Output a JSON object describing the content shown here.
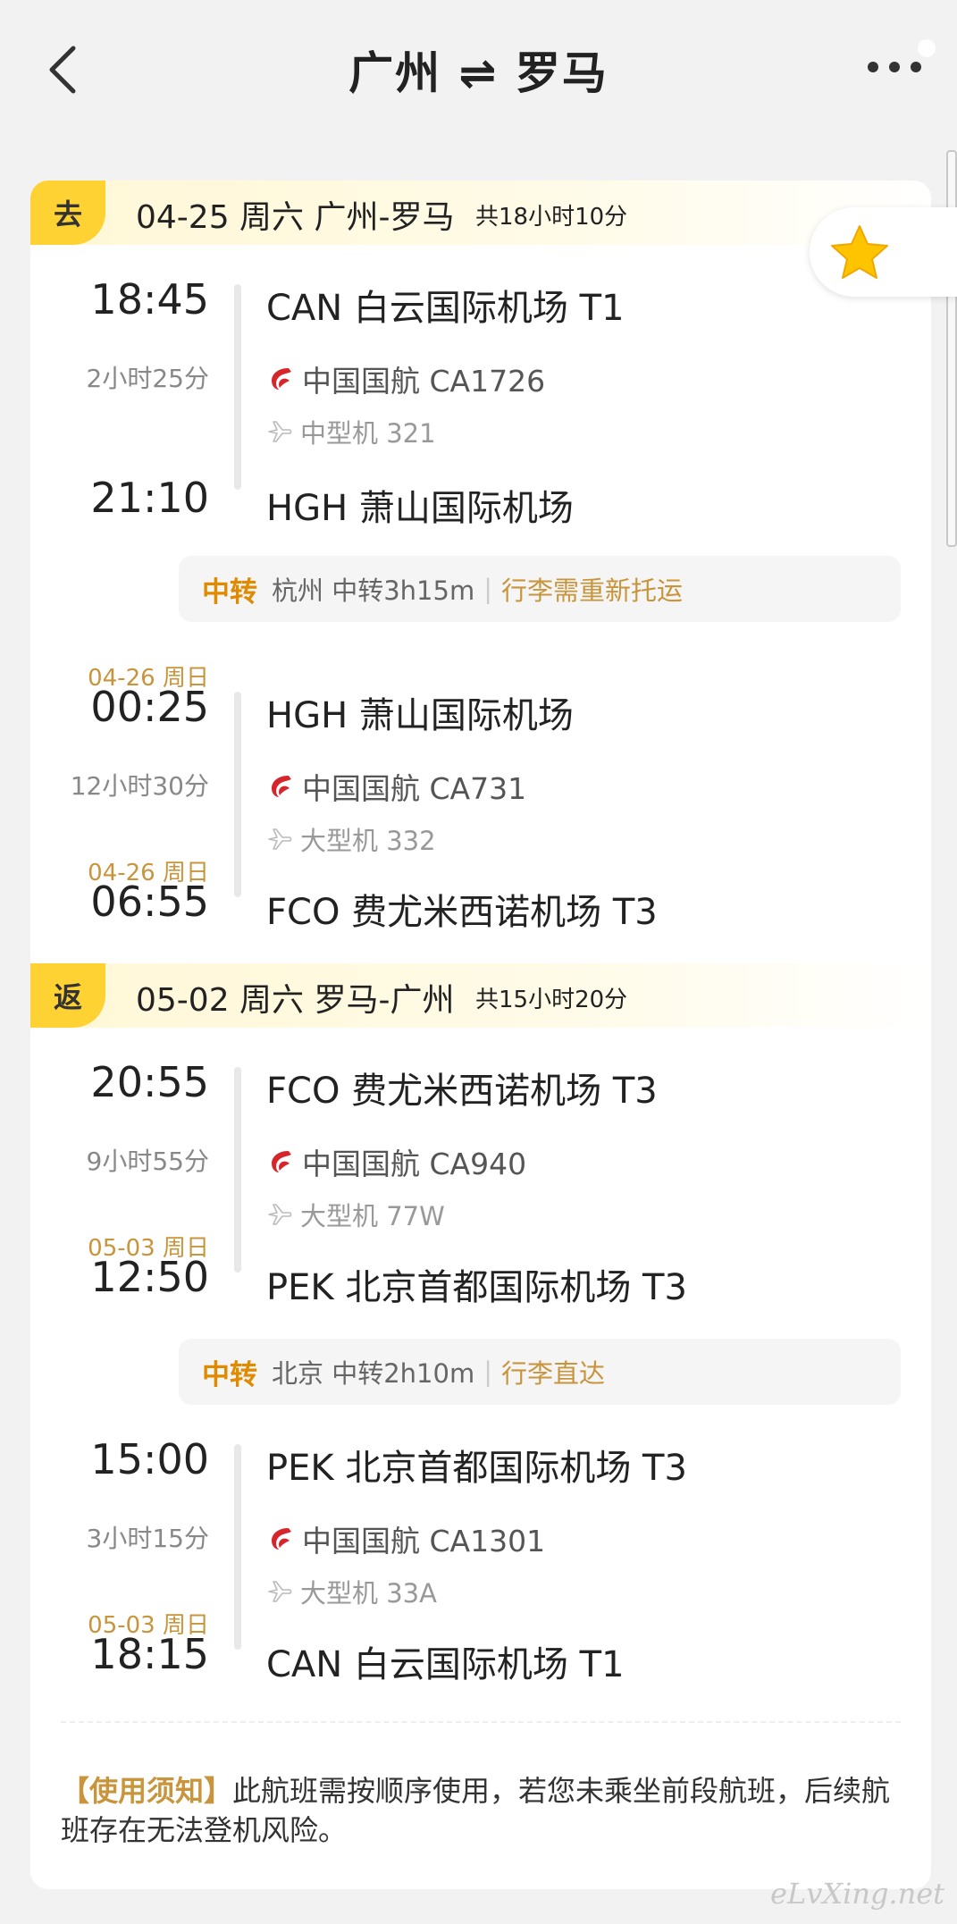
{
  "header": {
    "title": "广州 ⇌ 罗马"
  },
  "legs": [
    {
      "tag": "去",
      "date": "04-25 周六 广州-罗马",
      "total": "共18小时10分",
      "segments": [
        {
          "dep_time": "18:45",
          "dep_airport": "CAN 白云国际机场 T1",
          "duration": "2小时25分",
          "airline": "中国国航 CA1726",
          "plane": "中型机 321",
          "arr_time": "21:10",
          "arr_airport": "HGH 萧山国际机场"
        },
        {
          "dep_date": "04-26 周日",
          "dep_time": "00:25",
          "dep_airport": "HGH 萧山国际机场",
          "duration": "12小时30分",
          "airline": "中国国航 CA731",
          "plane": "大型机 332",
          "arr_date": "04-26 周日",
          "arr_time": "06:55",
          "arr_airport": "FCO 费尤米西诺机场 T3"
        }
      ],
      "transfer": {
        "label": "中转",
        "info": "杭州 中转3h15m",
        "baggage": "行李需重新托运"
      }
    },
    {
      "tag": "返",
      "date": "05-02 周六 罗马-广州",
      "total": "共15小时20分",
      "segments": [
        {
          "dep_time": "20:55",
          "dep_airport": "FCO 费尤米西诺机场 T3",
          "duration": "9小时55分",
          "airline": "中国国航 CA940",
          "plane": "大型机 77W",
          "arr_date": "05-03 周日",
          "arr_time": "12:50",
          "arr_airport": "PEK 北京首都国际机场 T3"
        },
        {
          "dep_time": "15:00",
          "dep_airport": "PEK 北京首都国际机场 T3",
          "duration": "3小时15分",
          "airline": "中国国航 CA1301",
          "plane": "大型机 33A",
          "arr_date": "05-03 周日",
          "arr_time": "18:15",
          "arr_airport": "CAN 白云国际机场 T1"
        }
      ],
      "transfer": {
        "label": "中转",
        "info": "北京 中转2h10m",
        "baggage": "行李直达"
      }
    }
  ],
  "notice": {
    "label": "【使用须知】",
    "text": "此航班需按顺序使用，若您未乘坐前段航班，后续航班存在无法登机风险。"
  },
  "watermark": "eLvXing.net",
  "colors": {
    "accent": "#ffd234",
    "transfer": "#e08a00",
    "date": "#c8953c",
    "airline_logo": "#d7262b"
  }
}
